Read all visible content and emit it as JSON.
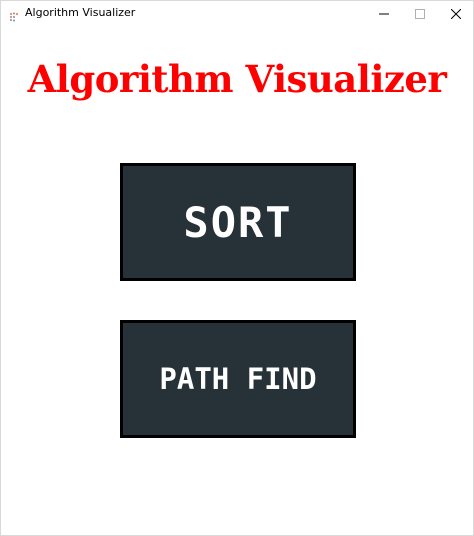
{
  "window": {
    "title": "Algorithm Visualizer",
    "minimize_icon": "minimize-icon",
    "maximize_icon": "maximize-icon",
    "close_icon": "close-icon"
  },
  "main": {
    "heading": "Algorithm Visualizer",
    "buttons": [
      {
        "label": "SORT"
      },
      {
        "label": "PATH FIND"
      }
    ]
  },
  "colors": {
    "heading": "#ff0000",
    "button_bg": "#263238",
    "button_text": "#ffffff",
    "button_border": "#000000"
  }
}
